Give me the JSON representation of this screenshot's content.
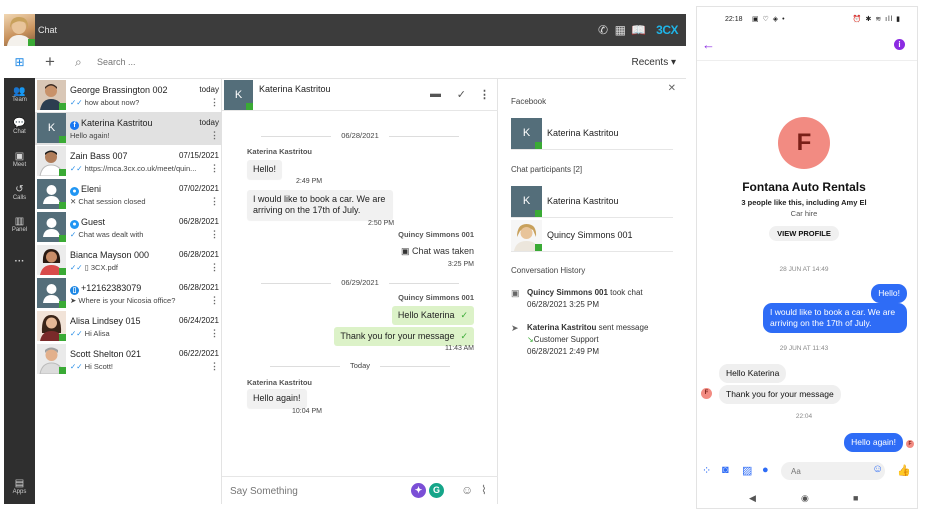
{
  "app": {
    "title": "Chat",
    "brand": "3CX",
    "rail": [
      {
        "label": "",
        "icon": "windows-icon"
      },
      {
        "label": "Team",
        "icon": "team-icon"
      },
      {
        "label": "Chat",
        "icon": "chat-icon"
      },
      {
        "label": "Meet",
        "icon": "meet-icon"
      },
      {
        "label": "Calls",
        "icon": "calls-icon"
      },
      {
        "label": "Panel",
        "icon": "panel-icon"
      },
      {
        "label": "···",
        "icon": "more-icon"
      },
      {
        "label": "Apps",
        "icon": "apps-icon"
      }
    ],
    "search_placeholder": "Search ...",
    "recents_label": "Recents ▾",
    "conversations": [
      {
        "name": "George Brassington 002",
        "date": "today",
        "preview": "how about now?",
        "selected": false
      },
      {
        "name": "Katerina Kastritou",
        "date": "today",
        "preview": "Hello again!",
        "selected": true
      },
      {
        "name": "Zain Bass 007",
        "date": "07/15/2021",
        "preview": "https://mca.3cx.co.uk/meet/quin...",
        "selected": false
      },
      {
        "name": "Eleni",
        "date": "07/02/2021",
        "preview": "Chat session closed",
        "selected": false
      },
      {
        "name": "Guest",
        "date": "06/28/2021",
        "preview": "Chat was dealt with",
        "selected": false
      },
      {
        "name": "Bianca Mayson 000",
        "date": "06/28/2021",
        "preview": "3CX.pdf",
        "selected": false
      },
      {
        "name": "+12162383079",
        "date": "06/28/2021",
        "preview": "Where is your Nicosia office?",
        "selected": false
      },
      {
        "name": "Alisa Lindsey 015",
        "date": "06/24/2021",
        "preview": "Hi Alisa",
        "selected": false
      },
      {
        "name": "Scott Shelton 021",
        "date": "06/22/2021",
        "preview": "Hi Scott!",
        "selected": false
      }
    ],
    "chat": {
      "header_name": "Katerina Kastritou",
      "header_initial": "K",
      "day1": "06/28/2021",
      "day2": "06/29/2021",
      "day3": "Today",
      "m1_sender": "Katerina Kastritou",
      "m1_text": "Hello!",
      "m1_time": "2:49 PM",
      "m2_text": "I would like to book a car. We are arriving on the 17th of July.",
      "m2_time": "2:50 PM",
      "m3_sender": "Quincy Simmons 001",
      "m3_text": "Chat was taken",
      "m3_time": "3:25 PM",
      "m4_sender": "Quincy Simmons 001",
      "m4_text": "Hello Katerina",
      "m5_text": "Thank you for your message",
      "m5_time": "11:43 AM",
      "m6_sender": "Katerina Kastritou",
      "m6_text": "Hello again!",
      "m6_time": "10:04 PM",
      "composer_placeholder": "Say Something"
    },
    "info": {
      "facebook_label": "Facebook",
      "facebook_contact": "Katerina Kastritou",
      "participants_label": "Chat participants [2]",
      "participants": [
        "Katerina Kastritou",
        "Quincy Simmons 001"
      ],
      "history_label": "Conversation History",
      "h1_actor": "Quincy Simmons 001",
      "h1_action": "took chat",
      "h1_time": "06/28/2021 3:25 PM",
      "h2_actor": "Katerina Kastritou",
      "h2_action": "sent message",
      "h2_target": "Customer Support",
      "h2_time": "06/28/2021 2:49 PM"
    }
  },
  "phone": {
    "time": "22:18",
    "page_initial": "F",
    "page_title": "Fontana Auto Rentals",
    "page_sub": "3 people like this, including Amy El",
    "page_category": "Car hire",
    "view_profile": "VIEW PROFILE",
    "d1": "28 JUN AT 14:49",
    "p1": "Hello!",
    "p2": "I would like to book a car. We are arriving on the 17th of July.",
    "d2": "29 JUN AT 11:43",
    "p3": "Hello Katerina",
    "p4": "Thank you for your message",
    "d3": "22:04",
    "p5": "Hello again!",
    "input_placeholder": "Aa"
  },
  "colors": {
    "accent_3cx": "#1fb5e8",
    "status_green": "#3aaa35",
    "messenger_blue": "#2e6cf6",
    "messenger_purple": "#8b2be2"
  }
}
